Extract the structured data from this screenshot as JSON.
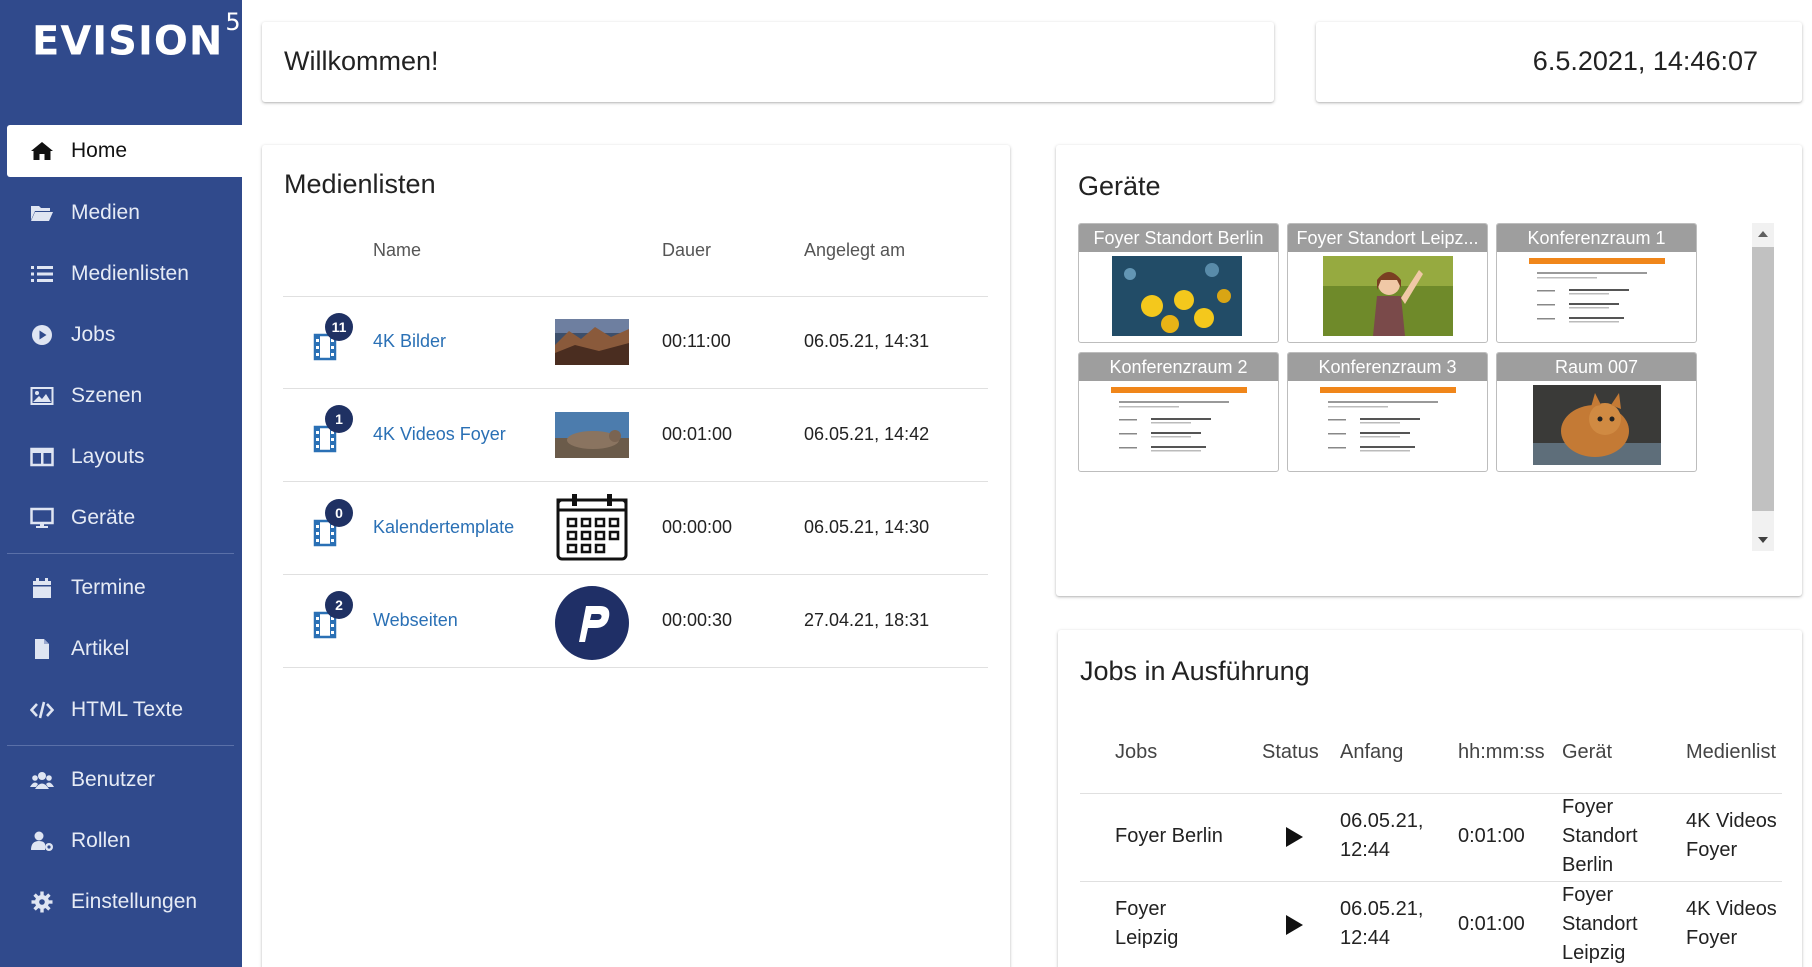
{
  "brand": {
    "name": "EVISION",
    "version": "5"
  },
  "sidebar": {
    "items": [
      {
        "label": "Home",
        "icon": "home-icon",
        "active": true
      },
      {
        "label": "Medien",
        "icon": "folder-open-icon"
      },
      {
        "label": "Medienlisten",
        "icon": "list-icon"
      },
      {
        "label": "Jobs",
        "icon": "play-circle-icon"
      },
      {
        "label": "Szenen",
        "icon": "image-icon"
      },
      {
        "label": "Layouts",
        "icon": "columns-icon"
      },
      {
        "label": "Geräte",
        "icon": "desktop-icon"
      },
      {
        "label": "Termine",
        "icon": "calendar-icon"
      },
      {
        "label": "Artikel",
        "icon": "file-icon"
      },
      {
        "label": "HTML Texte",
        "icon": "code-icon"
      },
      {
        "label": "Benutzer",
        "icon": "users-icon"
      },
      {
        "label": "Rollen",
        "icon": "user-cog-icon"
      },
      {
        "label": "Einstellungen",
        "icon": "gear-icon"
      }
    ]
  },
  "welcome": {
    "text": "Willkommen!"
  },
  "clock": {
    "text": "6.5.2021, 14:46:07"
  },
  "medialists": {
    "title": "Medienlisten",
    "headers": {
      "name": "Name",
      "duration": "Dauer",
      "created": "Angelegt am"
    },
    "rows": [
      {
        "count": "11",
        "name": "4K Bilder",
        "duration": "00:11:00",
        "created": "06.05.21, 14:31",
        "thumb": "landscape-photo"
      },
      {
        "count": "1",
        "name": "4K Videos Foyer",
        "duration": "00:01:00",
        "created": "06.05.21, 14:42",
        "thumb": "seal-photo"
      },
      {
        "count": "0",
        "name": "Kalendertemplate",
        "duration": "00:00:00",
        "created": "06.05.21, 14:30",
        "thumb": "calendar-icon"
      },
      {
        "count": "2",
        "name": "Webseiten",
        "duration": "00:00:30",
        "created": "27.04.21, 18:31",
        "thumb": "p-logo"
      }
    ]
  },
  "devices": {
    "title": "Geräte",
    "items": [
      {
        "name": "Foyer Standort Berlin",
        "preview": "bokeh-photo"
      },
      {
        "name": "Foyer Standort Leipz...",
        "preview": "girl-photo"
      },
      {
        "name": "Konferenzraum 1",
        "preview": "agenda"
      },
      {
        "name": "Konferenzraum 2",
        "preview": "agenda"
      },
      {
        "name": "Konferenzraum 3",
        "preview": "agenda"
      },
      {
        "name": "Raum 007",
        "preview": "cat-photo"
      }
    ]
  },
  "jobs": {
    "title": "Jobs in Ausführung",
    "headers": {
      "job": "Jobs",
      "status": "Status",
      "start": "Anfang",
      "elapsed": "hh:mm:ss",
      "device": "Gerät",
      "medialist": "Medienlist"
    },
    "rows": [
      {
        "job": "Foyer Berlin",
        "start_date": "06.05.21,",
        "start_time": "12:44",
        "elapsed": "0:01:00",
        "device_lines": [
          "Foyer",
          "Standort",
          "Berlin"
        ],
        "medialist_lines": [
          "4K Videos",
          "Foyer"
        ]
      },
      {
        "job_lines": [
          "Foyer",
          "Leipzig"
        ],
        "start_date": "06.05.21,",
        "start_time": "12:44",
        "elapsed": "0:01:00",
        "device_lines": [
          "Foyer",
          "Standort",
          "Leipzig"
        ],
        "medialist_lines": [
          "4K Videos",
          "Foyer"
        ]
      }
    ]
  },
  "colors": {
    "sidebar": "#304a8c",
    "link": "#2a70b5",
    "badge": "#1f3163",
    "accent": "#f0861a"
  }
}
